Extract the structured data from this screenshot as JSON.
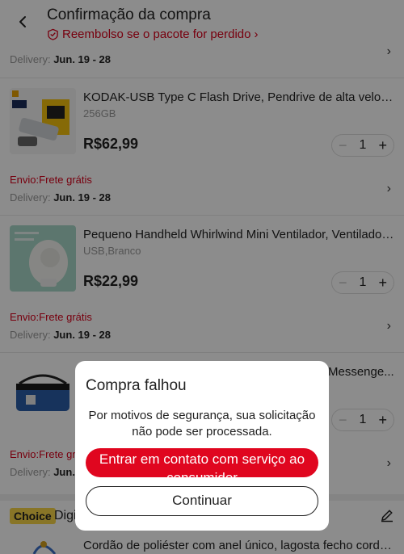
{
  "header": {
    "title": "Confirmação da compra",
    "refund_text": "Reembolso se o pacote for perdido",
    "refund_chevron": "›"
  },
  "delivery_top": {
    "label": "Delivery:",
    "date": "Jun. 19 - 28"
  },
  "products": [
    {
      "title": "KODAK-USB Type C Flash Drive, Pendrive de alta velocid...",
      "variant": "256GB",
      "price": "R$62,99",
      "quantity": "1",
      "shipping": "Envio:Frete grátis",
      "delivery_label": "Delivery:",
      "delivery_date": "Jun. 19 - 28"
    },
    {
      "title": "Pequeno Handheld Whirlwind Mini Ventilador, Ventilador ...",
      "variant": "USB,Branco",
      "price": "R$22,99",
      "quantity": "1",
      "shipping": "Envio:Frete grátis",
      "delivery_label": "Delivery:",
      "delivery_date": "Jun. 19 - 28"
    },
    {
      "title": "Messenge...",
      "quantity": "1",
      "shipping": "Envio:Frete gr",
      "delivery_label": "Delivery:",
      "delivery_date": "Jun. 1"
    }
  ],
  "choice": {
    "badge": "Choice",
    "text": "Digi"
  },
  "next_product_title": "Cordão de poliéster com anel único, lagosta fecho corda, ...",
  "stepper": {
    "minus": "−",
    "plus": "+"
  },
  "modal": {
    "title": "Compra falhou",
    "message": "Por motivos de segurança, sua solicitação não pode ser processada.",
    "primary_button": "Entrar em contato com serviço ao consumidor",
    "secondary_button": "Continuar"
  },
  "colors": {
    "accent": "#e0061f",
    "choice_badge": "#f7d648"
  },
  "icons": {
    "back": "back-arrow-icon",
    "refund": "shield-check-icon",
    "edit": "pencil-icon"
  }
}
